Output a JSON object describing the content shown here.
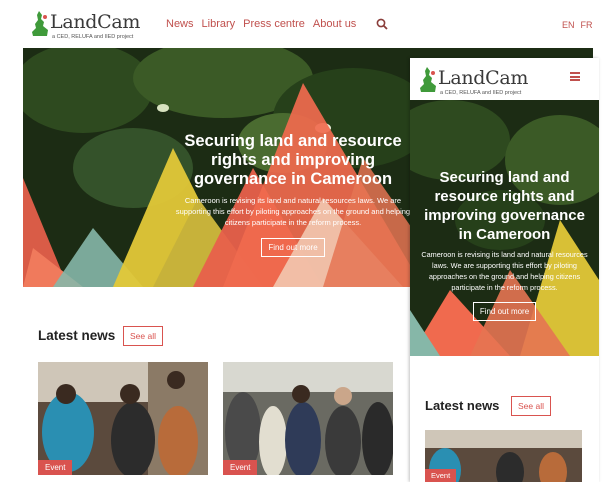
{
  "brand": {
    "name": "LandCam",
    "tagline": "a CED, RELUFA and IIED project"
  },
  "nav": {
    "items": [
      "News",
      "Library",
      "Press centre",
      "About us"
    ],
    "search_icon": "search-icon"
  },
  "languages": [
    "EN",
    "FR"
  ],
  "hero": {
    "title": "Securing land and resource rights and improving governance in Cameroon",
    "description": "Cameroon is revising its land and natural resources laws. We are supporting this effort by piloting approaches on the ground and helping citizens participate in the reform process.",
    "button": "Find out more"
  },
  "latest_news": {
    "title": "Latest news",
    "see_all": "See all",
    "cards": [
      {
        "badge": "Event"
      },
      {
        "badge": "Event"
      },
      {
        "badge": "Event"
      }
    ]
  },
  "mobile": {
    "menu_icon": "hamburger-menu-icon"
  },
  "colors": {
    "accent": "#d9534f",
    "nav_text": "#c0504d",
    "logo_green": "#3f9a3a"
  }
}
